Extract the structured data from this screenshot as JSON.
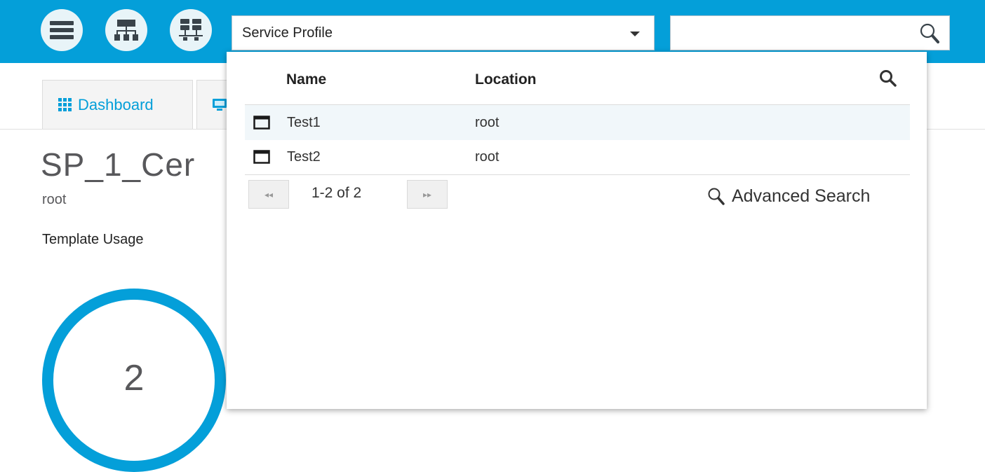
{
  "topbar": {
    "buttons": [
      {
        "icon": "menu-icon"
      },
      {
        "icon": "hierarchy-icon"
      },
      {
        "icon": "equipment-icon"
      }
    ],
    "object_type_select": {
      "value": "Service Profile"
    },
    "search": {
      "value": "",
      "icon": "search-icon"
    },
    "color": "#049fd9"
  },
  "page": {
    "tabs": [
      {
        "label": "Dashboard",
        "icon": "grid-icon"
      },
      {
        "label": "",
        "icon": "monitor-icon"
      }
    ],
    "title": "SP_1_Cer",
    "subtitle": "root",
    "section_label": "Template Usage",
    "usage_count": "2"
  },
  "dropdown": {
    "columns": {
      "name": "Name",
      "location": "Location"
    },
    "rows": [
      {
        "name": "Test1",
        "location": "root",
        "icon": "service-profile-icon"
      },
      {
        "name": "Test2",
        "location": "root",
        "icon": "service-profile-icon"
      }
    ],
    "pagination": {
      "text": "1-2 of 2",
      "prev": "◂◂",
      "next": "▸▸"
    },
    "advanced_search": "Advanced Search"
  }
}
